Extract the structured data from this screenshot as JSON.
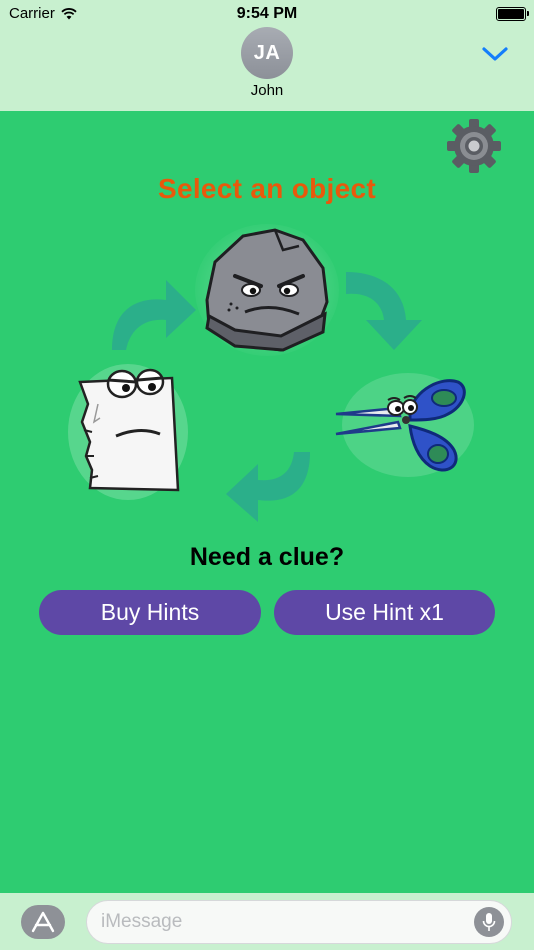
{
  "status_bar": {
    "carrier": "Carrier",
    "time": "9:54 PM"
  },
  "conversation": {
    "avatar_initials": "JA",
    "contact_name": "John"
  },
  "game": {
    "title": "Select an object",
    "clue_prompt": "Need a clue?",
    "buy_hints_label": "Buy Hints",
    "use_hint_label": "Use Hint x1",
    "objects": [
      "rock",
      "paper",
      "scissors"
    ],
    "colors": {
      "background": "#2ecc71",
      "title": "#e8590c",
      "button": "#5e48a6",
      "arrow": "#27ae8f"
    }
  },
  "compose": {
    "placeholder": "iMessage"
  },
  "icons": [
    "wifi-icon",
    "battery-icon",
    "chevron-down-icon",
    "settings-gear-icon",
    "app-store-icon",
    "microphone-icon"
  ]
}
